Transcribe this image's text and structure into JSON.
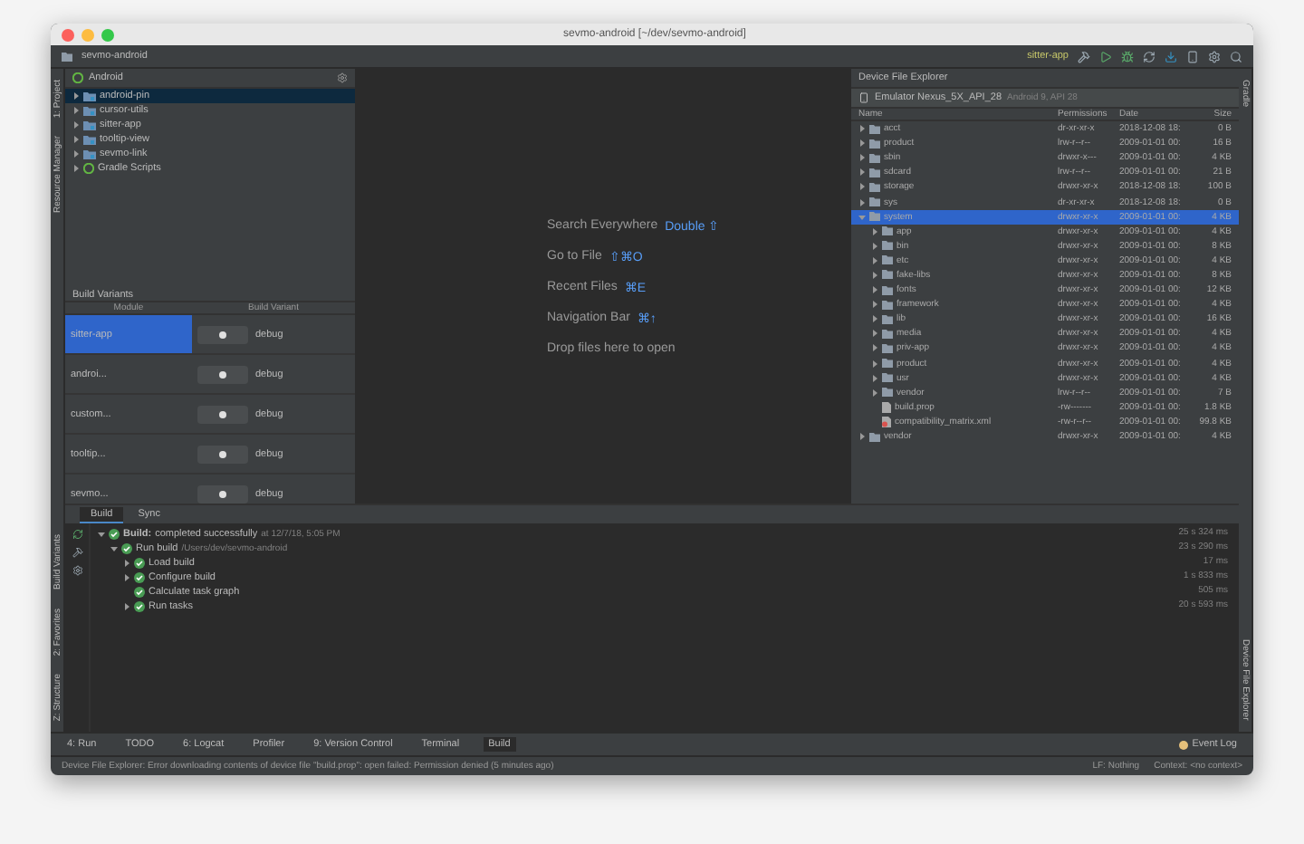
{
  "window": {
    "title": "sevmo-android [~/dev/sevmo-android]"
  },
  "navbar": {
    "path": "sevmo-android",
    "run_config": "sitter-app"
  },
  "left_stripe": {
    "top": [
      "1: Project",
      "Resource Manager"
    ],
    "bottom": [
      "Build Variants",
      "2: Favorites",
      "Z: Structure"
    ]
  },
  "right_stripe": {
    "top": [
      "Gradle"
    ],
    "bottom": [
      "Device File Explorer"
    ]
  },
  "project": {
    "view": "Android",
    "items": [
      {
        "label": "android-pin",
        "kind": "module",
        "selected": true
      },
      {
        "label": "cursor-utils",
        "kind": "module",
        "selected": false
      },
      {
        "label": "sitter-app",
        "kind": "module",
        "selected": false
      },
      {
        "label": "tooltip-view",
        "kind": "module",
        "selected": false
      },
      {
        "label": "sevmo-link",
        "kind": "module",
        "selected": false
      },
      {
        "label": "Gradle Scripts",
        "kind": "gradle",
        "selected": false
      }
    ]
  },
  "build_variants": {
    "title": "Build Variants",
    "columns": [
      "Module",
      "Build Variant"
    ],
    "rows": [
      {
        "module": "sitter-app",
        "variant": "debug",
        "selected": true
      },
      {
        "module": "androi...",
        "variant": "debug",
        "selected": false
      },
      {
        "module": "custom...",
        "variant": "debug",
        "selected": false
      },
      {
        "module": "tooltip...",
        "variant": "debug",
        "selected": false
      },
      {
        "module": "sevmo...",
        "variant": "debug",
        "selected": false
      }
    ]
  },
  "editor": {
    "hints": [
      {
        "label": "Search Everywhere",
        "shortcut": "Double ⇧"
      },
      {
        "label": "Go to File",
        "shortcut": "⇧⌘O"
      },
      {
        "label": "Recent Files",
        "shortcut": "⌘E"
      },
      {
        "label": "Navigation Bar",
        "shortcut": "⌘↑"
      }
    ],
    "drop": "Drop files here to open"
  },
  "device_file_explorer": {
    "title": "Device File Explorer",
    "device": "Emulator Nexus_5X_API_28",
    "device_info": "Android 9, API 28",
    "columns": [
      "Name",
      "Permissions",
      "Date",
      "Size"
    ],
    "rows": [
      {
        "name": "acct",
        "kind": "folder",
        "expanded": false,
        "selected": false,
        "permissions": "dr-xr-xr-x",
        "date": "2018-12-08 18:",
        "size": "0 B"
      },
      {
        "name": "product",
        "kind": "folder",
        "expanded": false,
        "selected": false,
        "permissions": "lrw-r--r--",
        "date": "2009-01-01 00:",
        "size": "16 B"
      },
      {
        "name": "sbin",
        "kind": "folder",
        "expanded": false,
        "selected": false,
        "permissions": "drwxr-x---",
        "date": "2009-01-01 00:",
        "size": "4 KB"
      },
      {
        "name": "sdcard",
        "kind": "folder",
        "expanded": false,
        "selected": false,
        "permissions": "lrw-r--r--",
        "date": "2009-01-01 00:",
        "size": "21 B"
      },
      {
        "name": "storage",
        "kind": "folder",
        "expanded": false,
        "selected": false,
        "permissions": "drwxr-xr-x",
        "date": "2018-12-08 18:",
        "size": "100 B"
      },
      {
        "name": "sys",
        "kind": "folder",
        "expanded": false,
        "selected": false,
        "permissions": "dr-xr-xr-x",
        "date": "2018-12-08 18:",
        "size": "0 B"
      },
      {
        "name": "system",
        "kind": "folder",
        "expanded": true,
        "selected": true,
        "permissions": "drwxr-xr-x",
        "date": "2009-01-01 00:",
        "size": "4 KB",
        "children": [
          {
            "name": "app",
            "kind": "folder",
            "expanded": false,
            "selected": false,
            "permissions": "drwxr-xr-x",
            "date": "2009-01-01 00:",
            "size": "4 KB"
          },
          {
            "name": "bin",
            "kind": "folder",
            "expanded": false,
            "selected": false,
            "permissions": "drwxr-xr-x",
            "date": "2009-01-01 00:",
            "size": "8 KB"
          },
          {
            "name": "etc",
            "kind": "folder",
            "expanded": false,
            "selected": false,
            "permissions": "drwxr-xr-x",
            "date": "2009-01-01 00:",
            "size": "4 KB"
          },
          {
            "name": "fake-libs",
            "kind": "folder",
            "expanded": false,
            "selected": false,
            "permissions": "drwxr-xr-x",
            "date": "2009-01-01 00:",
            "size": "8 KB"
          },
          {
            "name": "fonts",
            "kind": "folder",
            "expanded": false,
            "selected": false,
            "permissions": "drwxr-xr-x",
            "date": "2009-01-01 00:",
            "size": "12 KB"
          },
          {
            "name": "framework",
            "kind": "folder",
            "expanded": false,
            "selected": false,
            "permissions": "drwxr-xr-x",
            "date": "2009-01-01 00:",
            "size": "4 KB"
          },
          {
            "name": "lib",
            "kind": "folder",
            "expanded": false,
            "selected": false,
            "permissions": "drwxr-xr-x",
            "date": "2009-01-01 00:",
            "size": "16 KB"
          },
          {
            "name": "media",
            "kind": "folder",
            "expanded": false,
            "selected": false,
            "permissions": "drwxr-xr-x",
            "date": "2009-01-01 00:",
            "size": "4 KB"
          },
          {
            "name": "priv-app",
            "kind": "folder",
            "expanded": false,
            "selected": false,
            "permissions": "drwxr-xr-x",
            "date": "2009-01-01 00:",
            "size": "4 KB"
          },
          {
            "name": "product",
            "kind": "folder",
            "expanded": false,
            "selected": false,
            "permissions": "drwxr-xr-x",
            "date": "2009-01-01 00:",
            "size": "4 KB"
          },
          {
            "name": "usr",
            "kind": "folder",
            "expanded": false,
            "selected": false,
            "permissions": "drwxr-xr-x",
            "date": "2009-01-01 00:",
            "size": "4 KB"
          },
          {
            "name": "vendor",
            "kind": "folder",
            "expanded": false,
            "selected": false,
            "permissions": "lrw-r--r--",
            "date": "2009-01-01 00:",
            "size": "7 B"
          },
          {
            "name": "build.prop",
            "kind": "file",
            "selected": false,
            "permissions": "-rw-------",
            "date": "2009-01-01 00:",
            "size": "1.8 KB"
          },
          {
            "name": "compatibility_matrix.xml",
            "kind": "error-file",
            "selected": false,
            "permissions": "-rw-r--r--",
            "date": "2009-01-01 00:",
            "size": "99.8 KB"
          }
        ]
      },
      {
        "name": "vendor",
        "kind": "folder",
        "expanded": false,
        "selected": false,
        "permissions": "drwxr-xr-x",
        "date": "2009-01-01 00:",
        "size": "4 KB"
      }
    ]
  },
  "build": {
    "tabs": [
      {
        "label": "Build",
        "selected": true
      },
      {
        "label": "Sync",
        "selected": false
      }
    ],
    "tree": [
      {
        "label": "Build:",
        "rest": "completed successfully",
        "note": "at 12/7/18, 5:05 PM",
        "time": "25 s 324 ms",
        "expanded": true,
        "children": [
          {
            "label": "Run build",
            "note": "/Users/dev/sevmo-android",
            "time": "23 s 290 ms",
            "expanded": true,
            "children": [
              {
                "label": "Load build",
                "time": "17 ms",
                "expanded": false
              },
              {
                "label": "Configure build",
                "time": "1 s 833 ms",
                "expanded": false
              },
              {
                "label": "Calculate task graph",
                "time": "505 ms"
              },
              {
                "label": "Run tasks",
                "time": "20 s 593 ms",
                "expanded": false
              }
            ]
          }
        ]
      }
    ]
  },
  "tool_windows": [
    {
      "label": "4: Run",
      "selected": false
    },
    {
      "label": "TODO",
      "selected": false
    },
    {
      "label": "6: Logcat",
      "selected": false
    },
    {
      "label": "Profiler",
      "selected": false
    },
    {
      "label": "9: Version Control",
      "selected": false
    },
    {
      "label": "Terminal",
      "selected": false
    },
    {
      "label": "Build",
      "selected": true
    }
  ],
  "event_log": "Event Log",
  "status_bar": {
    "message": "Device File Explorer: Error downloading contents of device file \"build.prop\": open failed: Permission denied (5 minutes ago)",
    "right": [
      "LF: Nothing",
      "Context: <no context>"
    ]
  }
}
